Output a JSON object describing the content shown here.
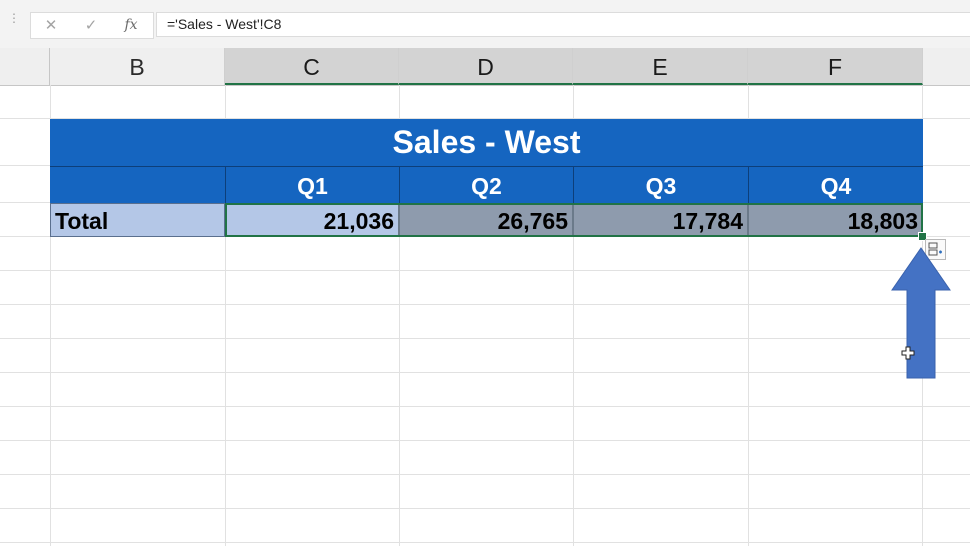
{
  "formula_bar": {
    "cancel_icon": "close-icon",
    "enter_icon": "check-icon",
    "fx_label": "fx",
    "formula": "='Sales - West'!C8"
  },
  "columns": {
    "B": "B",
    "C": "C",
    "D": "D",
    "E": "E",
    "F": "F"
  },
  "table": {
    "title": "Sales - West",
    "quarters": [
      "Q1",
      "Q2",
      "Q3",
      "Q4"
    ],
    "row_label": "Total",
    "values": [
      "21,036",
      "26,765",
      "17,784",
      "18,803"
    ]
  },
  "colors": {
    "header_blue": "#1565c0",
    "light_blue": "#b4c7e7",
    "selected_gray": "#8e9bad",
    "selection_green": "#217346",
    "arrow_blue": "#4472c4"
  },
  "annotations": {
    "arrow_icon": "up-arrow-icon",
    "paste_options_icon": "paste-options-icon",
    "cursor_icon": "cell-cursor-icon"
  }
}
